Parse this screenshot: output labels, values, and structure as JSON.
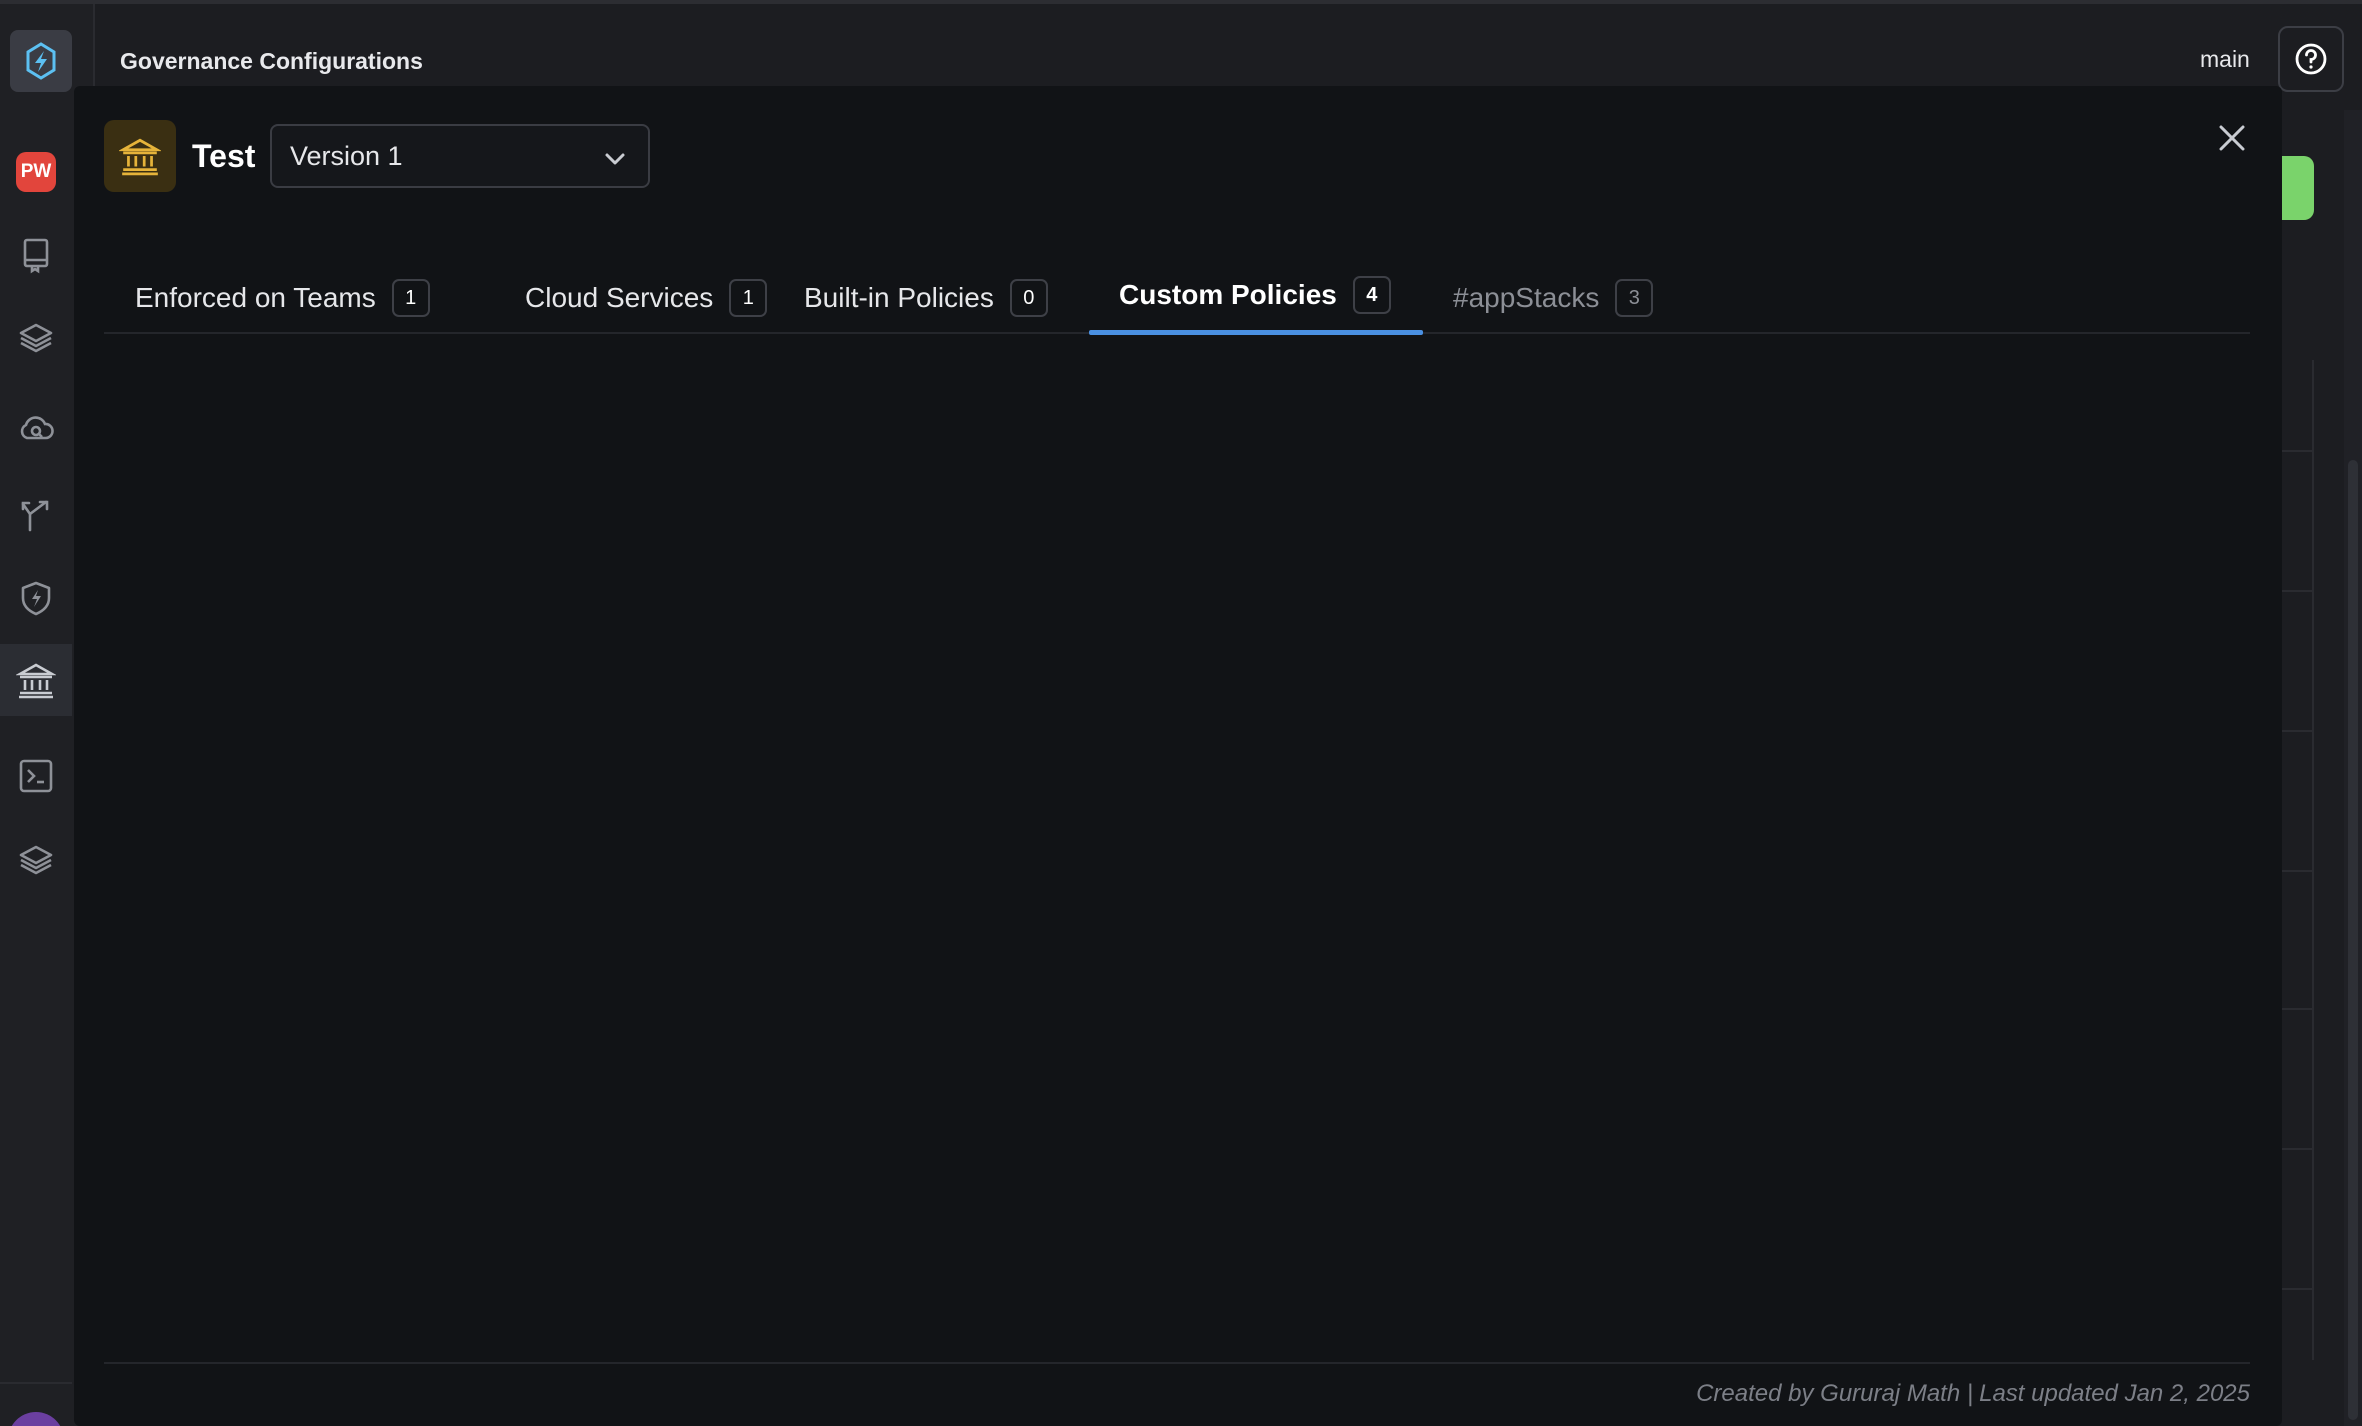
{
  "header": {
    "title": "Governance Configurations",
    "branch": "main"
  },
  "sidebar": {
    "items": [
      {
        "name": "workspace-pw",
        "label": "PW"
      },
      {
        "name": "catalog",
        "icon": "book-icon"
      },
      {
        "name": "stacks",
        "icon": "layers-icon"
      },
      {
        "name": "cloud",
        "icon": "cloud-search-icon"
      },
      {
        "name": "pipelines",
        "icon": "branch-icon"
      },
      {
        "name": "security",
        "icon": "shield-bolt-icon"
      },
      {
        "name": "governance",
        "icon": "bank-icon",
        "active": true
      },
      {
        "name": "terminal",
        "icon": "terminal-icon"
      },
      {
        "name": "layers",
        "icon": "layers-icon"
      }
    ]
  },
  "modal": {
    "name": "Test",
    "version": "Version 1",
    "tabs": [
      {
        "label": "Enforced on Teams",
        "count": "1"
      },
      {
        "label": "Cloud Services",
        "count": "1"
      },
      {
        "label": "Built-in Policies",
        "count": "0"
      },
      {
        "label": "Custom Policies",
        "count": "4",
        "active": true
      },
      {
        "label": "#appStacks",
        "count": "3"
      }
    ],
    "footer": {
      "created_by": "Created by Gururaj Math |",
      "last_updated": "Last updated Jan 2, 2025"
    }
  },
  "colors": {
    "accent": "#4a90e2",
    "pw_badge": "#e2453c",
    "green_button": "#7ad36b",
    "gov_icon": "#e6b43a"
  }
}
